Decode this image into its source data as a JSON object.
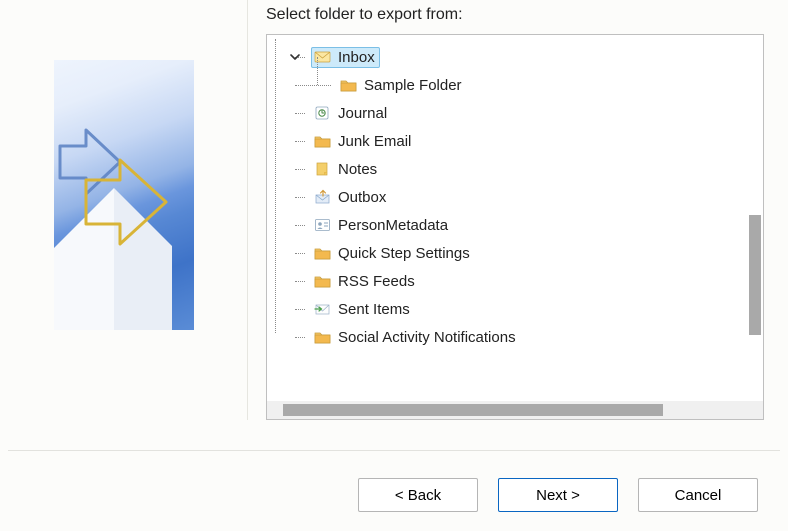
{
  "instruction": "Select folder to export from:",
  "tree": {
    "selected_index": 0,
    "items": [
      {
        "label": "Inbox",
        "icon": "inbox-icon",
        "depth": 0,
        "expanded": true
      },
      {
        "label": "Sample Folder",
        "icon": "folder-icon",
        "depth": 1
      },
      {
        "label": "Journal",
        "icon": "journal-icon",
        "depth": 0
      },
      {
        "label": "Junk Email",
        "icon": "folder-icon",
        "depth": 0
      },
      {
        "label": "Notes",
        "icon": "notes-icon",
        "depth": 0
      },
      {
        "label": "Outbox",
        "icon": "outbox-icon",
        "depth": 0
      },
      {
        "label": "PersonMetadata",
        "icon": "contact-icon",
        "depth": 0
      },
      {
        "label": "Quick Step Settings",
        "icon": "folder-icon",
        "depth": 0
      },
      {
        "label": "RSS Feeds",
        "icon": "folder-icon",
        "depth": 0
      },
      {
        "label": "Sent Items",
        "icon": "sent-icon",
        "depth": 0
      },
      {
        "label": "Social Activity Notifications",
        "icon": "folder-icon",
        "depth": 0
      }
    ]
  },
  "buttons": {
    "back": "< Back",
    "next": "Next >",
    "cancel": "Cancel"
  }
}
